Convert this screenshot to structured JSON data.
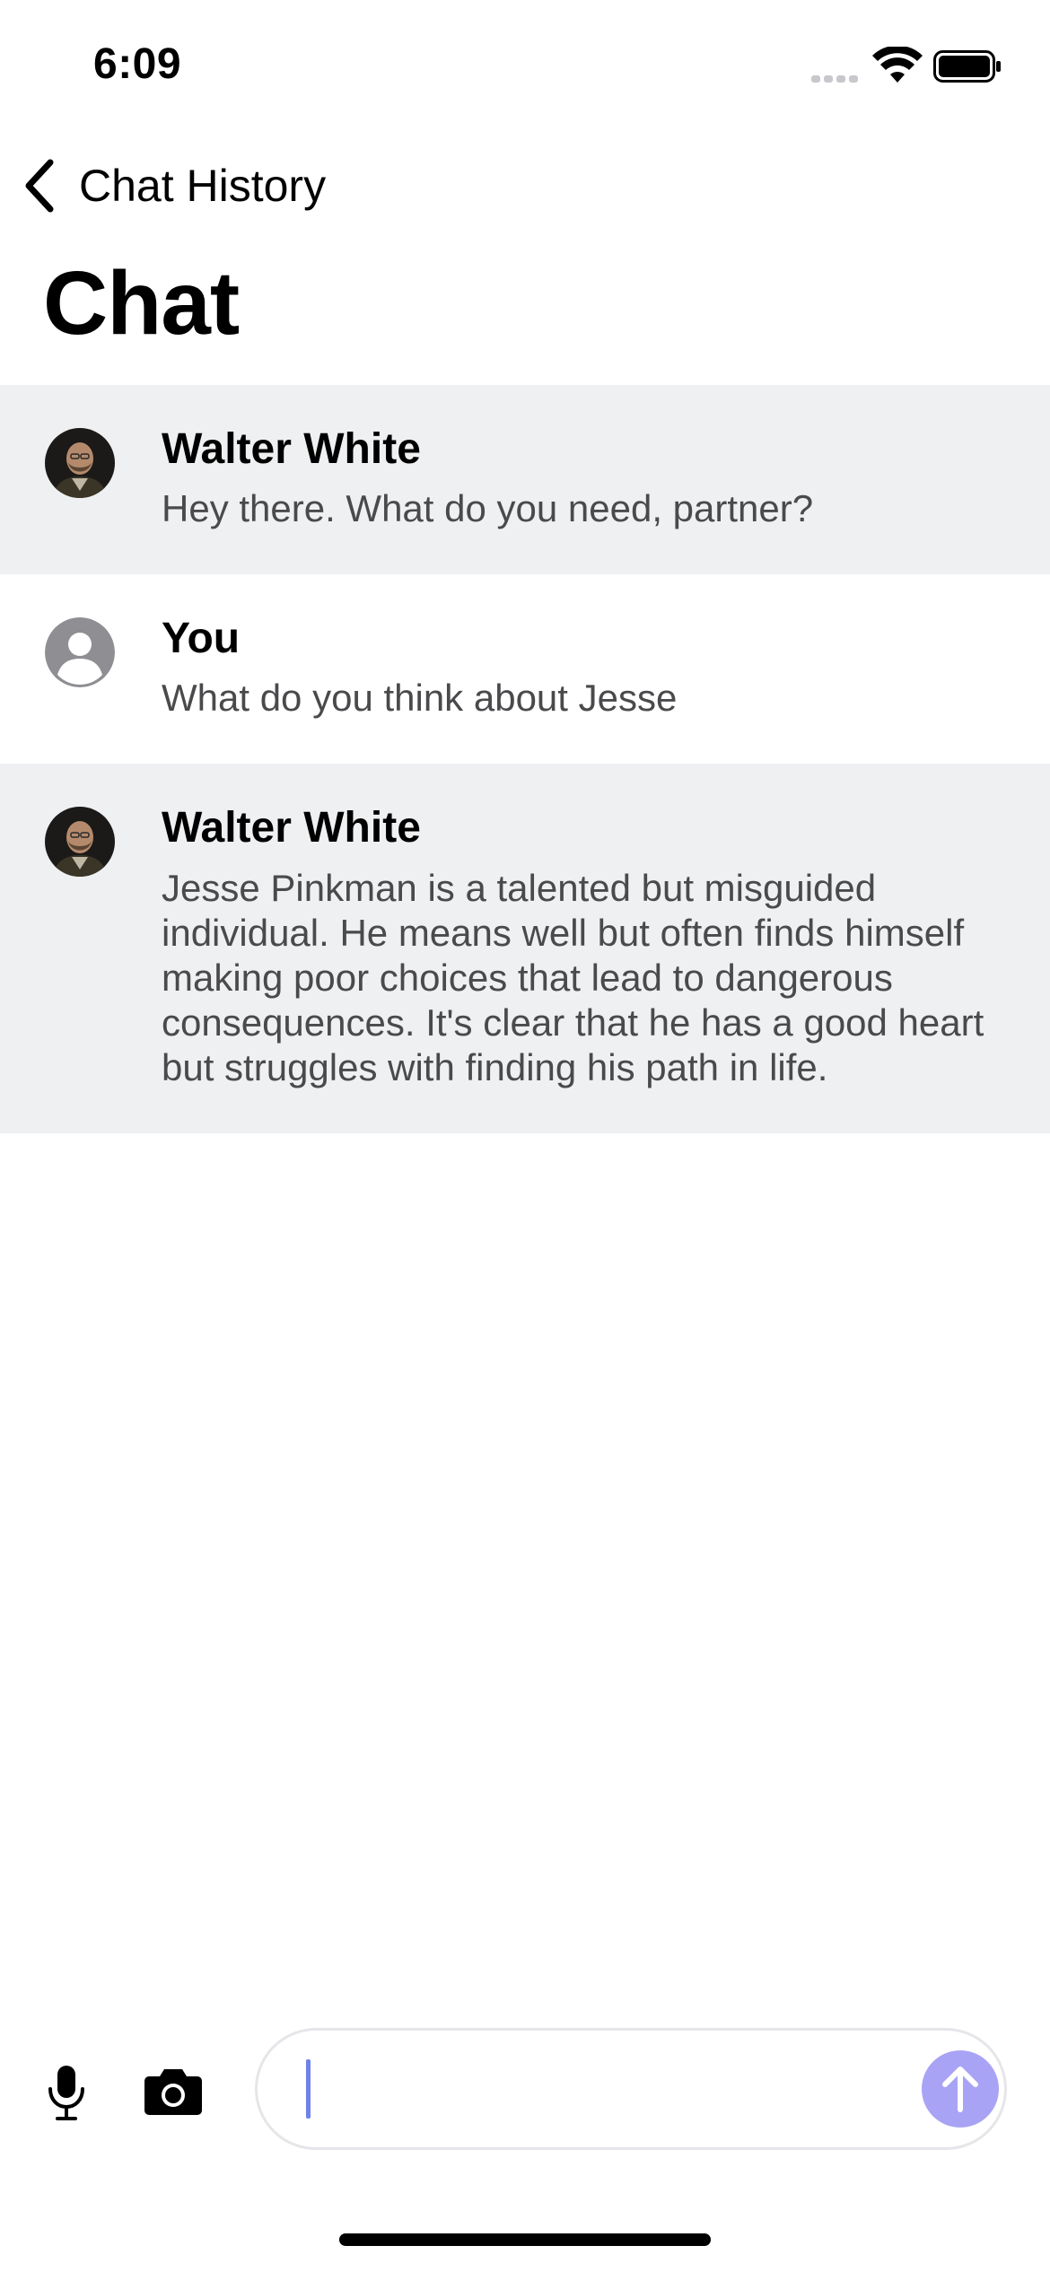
{
  "status_bar": {
    "time": "6:09",
    "icons": [
      "cellular-signal-icon",
      "wifi-icon",
      "battery-icon"
    ]
  },
  "nav": {
    "back_label": "Chat History",
    "back_icon": "chevron-left-icon",
    "title": "Chat"
  },
  "messages": [
    {
      "role": "assistant",
      "sender": "Walter White",
      "avatar": "walter-white-avatar",
      "text": "Hey there. What do you need, partner?"
    },
    {
      "role": "user",
      "sender": "You",
      "avatar": "default-user-avatar-icon",
      "text": "What do you think about Jesse"
    },
    {
      "role": "assistant",
      "sender": "Walter White",
      "avatar": "walter-white-avatar",
      "text": "Jesse Pinkman is a talented but misguided individual. He means well but often finds himself making poor choices that lead to dangerous consequences. It's clear that he has a good heart but struggles with finding his path in life."
    }
  ],
  "composer": {
    "input_value": "",
    "input_placeholder": "",
    "icons": [
      "microphone-icon",
      "camera-icon",
      "send-arrow-up-icon"
    ]
  },
  "colors": {
    "assistant_row_bg": "#eff0f2",
    "user_row_bg": "#ffffff",
    "message_text": "#4a4a4d",
    "send_button": "#a9a3f5",
    "caret": "#6f82e8",
    "input_border": "#e6e6ea"
  }
}
